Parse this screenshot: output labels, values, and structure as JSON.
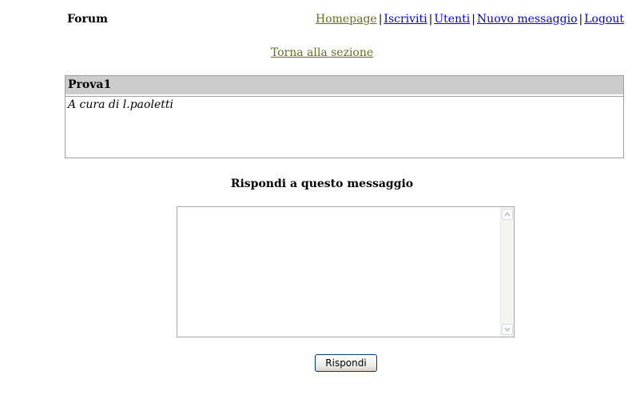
{
  "header": {
    "site_title": "Forum",
    "nav": [
      {
        "label": "Homepage",
        "state": "visited"
      },
      {
        "label": "Iscriviti",
        "state": "unvisited"
      },
      {
        "label": "Utenti",
        "state": "unvisited"
      },
      {
        "label": "Nuovo messaggio",
        "state": "unvisited"
      },
      {
        "label": "Logout",
        "state": "unvisited"
      }
    ],
    "separator": "|"
  },
  "back_link": "Torna alla sezione",
  "message": {
    "title": "Prova1",
    "author_line": "A cura di l.paoletti"
  },
  "reply": {
    "heading": "Rispondi a questo messaggio",
    "textarea_value": "",
    "button_label": "Rispondi"
  },
  "colors": {
    "visited_link": "#6b6b1f",
    "unvisited_link": "#0000ee",
    "header_bar": "#cccccc"
  },
  "icons": {
    "scroll_up": "chevron-up-icon",
    "scroll_down": "chevron-down-icon"
  }
}
